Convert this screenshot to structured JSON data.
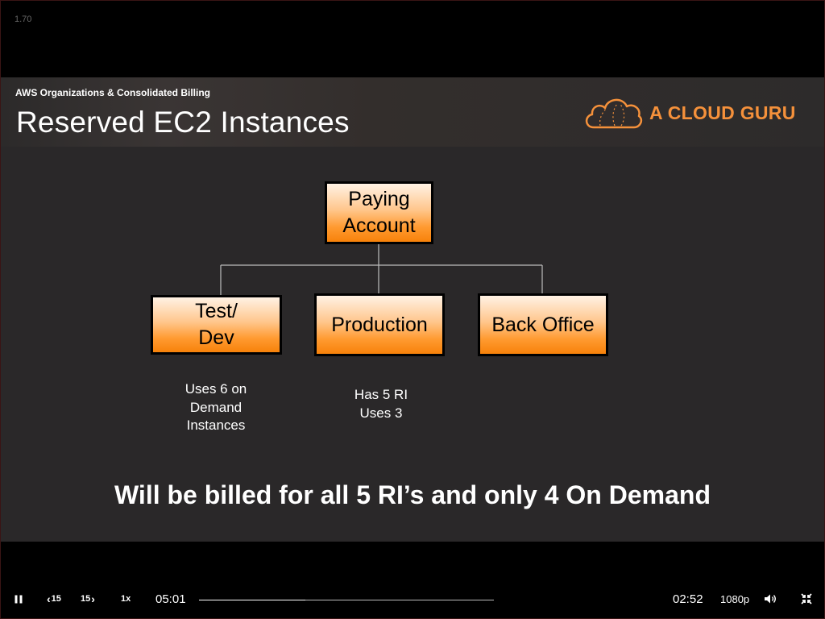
{
  "player": {
    "version": "1.70",
    "elapsed": "05:01",
    "remaining": "02:52",
    "speed": "1x",
    "quality": "1080p",
    "skip_back_label": "15",
    "skip_forward_label": "15",
    "progress_fraction": 0.36
  },
  "slide": {
    "subtitle": "AWS Organizations & Consolidated Billing",
    "title": "Reserved EC2 Instances",
    "brand": "A CLOUD GURU",
    "diagram": {
      "root": "Paying\nAccount",
      "children": [
        "Test/\nDev",
        "Production",
        "Back Office"
      ],
      "notes": {
        "test_dev": "Uses 6 on\nDemand\nInstances",
        "production": "Has 5 RI\nUses 3"
      }
    },
    "summary": "Will be billed for all 5 RI’s and only 4 On Demand"
  },
  "colors": {
    "brand_orange": "#f5913b",
    "box_gradient_end": "#f7820a",
    "slide_background": "#2a2829"
  }
}
